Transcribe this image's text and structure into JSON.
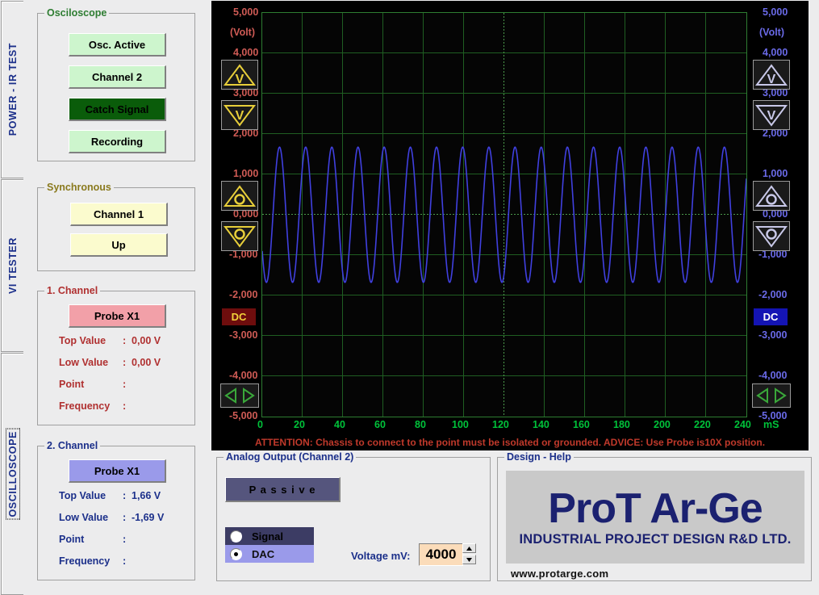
{
  "tabs": [
    {
      "id": "power",
      "label": "POWER - IR TEST",
      "selected": false
    },
    {
      "id": "vi",
      "label": "VI  TESTER",
      "selected": false
    },
    {
      "id": "osc",
      "label": "OSCILLOSCOPE",
      "selected": true
    }
  ],
  "colors": {
    "face": "#ececed",
    "scope_bg": "#000000",
    "grid": "#1f5e22",
    "trace": "#4040e0",
    "left_axis": "#cf5b55",
    "right_axis": "#6a6ae8",
    "x_axis": "#00c23a",
    "warning": "#c0392b",
    "brand": "#1b2170"
  },
  "osciloscope": {
    "legend": "Osciloscope",
    "buttons": [
      {
        "label": "Osc. Active",
        "state": "idle"
      },
      {
        "label": "Channel 2",
        "state": "idle"
      },
      {
        "label": "Catch Signal",
        "state": "active"
      },
      {
        "label": "Recording",
        "state": "idle"
      }
    ]
  },
  "synchronous": {
    "legend": "Synchronous",
    "buttons": [
      {
        "label": "Channel 1"
      },
      {
        "label": "Up"
      }
    ]
  },
  "channel1": {
    "legend": "1. Channel",
    "probe_label": "Probe X1",
    "rows": [
      {
        "name": "Top Value",
        "sep": ":",
        "value": "0,00 V"
      },
      {
        "name": "Low Value",
        "sep": ":",
        "value": "0,00 V"
      },
      {
        "name": "Point",
        "sep": ":",
        "value": ""
      },
      {
        "name": "Frequency",
        "sep": ":",
        "value": ""
      }
    ]
  },
  "channel2": {
    "legend": "2. Channel",
    "probe_label": "Probe X1",
    "rows": [
      {
        "name": "Top Value",
        "sep": ":",
        "value": "1,66 V"
      },
      {
        "name": "Low Value",
        "sep": ":",
        "value": "-1,69 V"
      },
      {
        "name": "Point",
        "sep": ":",
        "value": ""
      },
      {
        "name": "Frequency",
        "sep": ":",
        "value": ""
      }
    ]
  },
  "scope": {
    "left_unit": "(Volt)",
    "right_unit": "(Volt)",
    "x_unit": "mS",
    "left_ticks": [
      "5,000",
      "4,000",
      "3,000",
      "2,000",
      "1,000",
      "0,000",
      "-1,000",
      "-2,000",
      "-3,000",
      "-4,000",
      "-5,000"
    ],
    "right_ticks": [
      "5,000",
      "4,000",
      "3,000",
      "2,000",
      "1,000",
      "0,000",
      "-1,000",
      "-2,000",
      "-3,000",
      "-4,000",
      "-5,000"
    ],
    "x_ticks": [
      "0",
      "20",
      "40",
      "60",
      "80",
      "100",
      "120",
      "140",
      "160",
      "180",
      "200",
      "220",
      "240"
    ],
    "left_coupling": "DC",
    "right_coupling": "DC",
    "icons": {
      "ch1_up_v": "triangle-up-v-icon",
      "ch1_down_v": "triangle-down-v-icon",
      "ch1_up_o": "triangle-up-o-icon",
      "ch1_down_o": "triangle-down-o-icon",
      "ch1_pan": "pan-left-right-icon",
      "ch2_up_v": "triangle-up-v-icon",
      "ch2_down_v": "triangle-down-v-icon",
      "ch2_up_o": "triangle-up-o-icon",
      "ch2_down_o": "triangle-down-o-icon",
      "ch2_pan": "pan-left-right-icon"
    }
  },
  "chart_data": {
    "type": "line",
    "title": "",
    "xlabel": "mS",
    "ylabel": "(Volt)",
    "xlim": [
      0,
      240
    ],
    "ylim": [
      -5000,
      5000
    ],
    "grid": true,
    "legend": "none",
    "series": [
      {
        "name": "Channel 2",
        "color": "#4040e0",
        "waveform": "sine",
        "amplitude_v": 1.675,
        "offset_v": 0.0,
        "cycles_on_screen": 18.5,
        "period_ms": 12.97,
        "top_value_v": 1.66,
        "low_value_v": -1.69
      }
    ]
  },
  "attention": "ATTENTION: Chassis to connect to the point must be isolated or grounded.  ADVICE: Use Probe is10X position.",
  "analog_output": {
    "legend": "Analog Output  (Channel 2)",
    "mode_button": "P a s s i v e",
    "options": [
      {
        "label": "Signal",
        "selected": false
      },
      {
        "label": "DAC",
        "selected": true
      }
    ],
    "voltage_label": "Voltage mV:",
    "voltage_value": "4000"
  },
  "design_help": {
    "legend": "Design - Help",
    "logo_main": "ProT Ar-Ge",
    "logo_sub": "INDUSTRIAL PROJECT DESIGN R&D LTD.",
    "url": "www.protarge.com"
  }
}
